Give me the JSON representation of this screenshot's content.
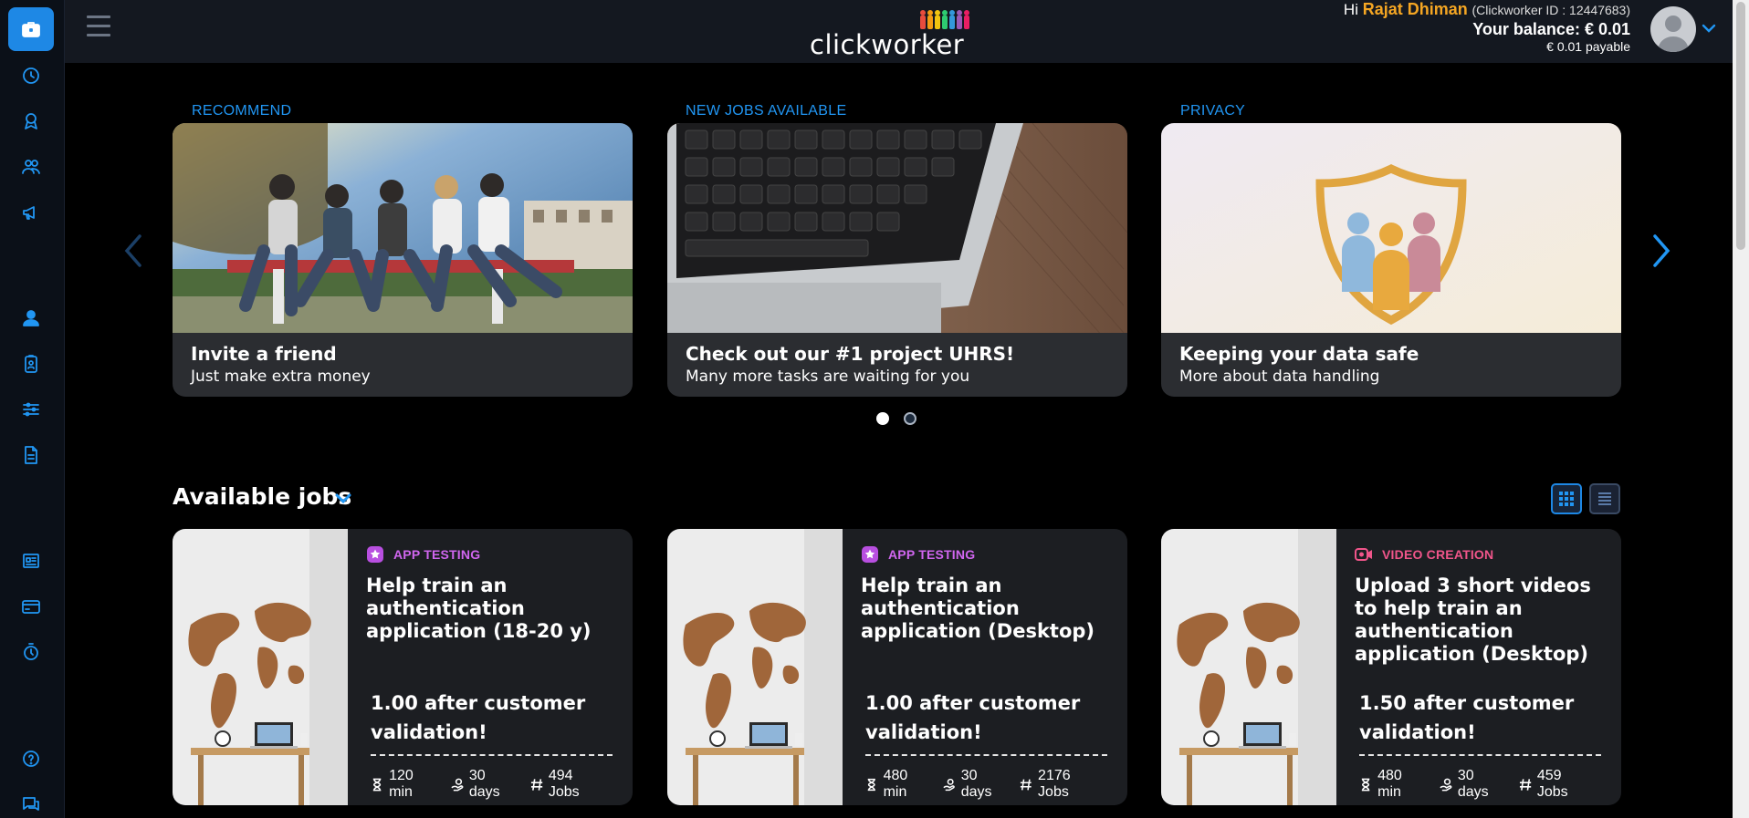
{
  "header": {
    "greeting": "Hi",
    "user_name": "Rajat Dhiman",
    "clickworker_id": "(Clickworker ID : 12447683)",
    "balance": "Your balance: € 0.01",
    "payable": "€ 0.01 payable",
    "logo_text": "clickworker"
  },
  "sidebar": {
    "items": [
      {
        "icon": "briefcase-icon"
      },
      {
        "icon": "timer-icon"
      },
      {
        "icon": "badge-icon"
      },
      {
        "icon": "users-icon"
      },
      {
        "icon": "megaphone-icon"
      },
      {
        "icon": "user-icon"
      },
      {
        "icon": "clipboard-user-icon"
      },
      {
        "icon": "sliders-icon"
      },
      {
        "icon": "document-icon"
      },
      {
        "icon": "news-icon"
      },
      {
        "icon": "credit-card-icon"
      },
      {
        "icon": "payout-timer-icon"
      },
      {
        "icon": "help-icon"
      },
      {
        "icon": "chat-icon"
      }
    ]
  },
  "carousel": {
    "slides": [
      {
        "label": "RECOMMEND",
        "title": "Invite a friend",
        "subtitle": "Just make extra money"
      },
      {
        "label": "NEW JOBS AVAILABLE",
        "title": "Check out our #1 project UHRS!",
        "subtitle": "Many more tasks are waiting for you"
      },
      {
        "label": "PRIVACY",
        "title": "Keeping your data safe",
        "subtitle": "More about data handling"
      }
    ],
    "active_dot": 1,
    "dot_count": 2
  },
  "jobs": {
    "heading": "Available jobs",
    "cards": [
      {
        "category": "APP TESTING",
        "category_color": "#d066ef",
        "category_icon": "star-badge-icon",
        "title": "Help train an authentication application (18-20 y)",
        "price": "1.00 after customer validation!",
        "duration": "120 min",
        "deadline": "30 days",
        "jobs": "494 Jobs"
      },
      {
        "category": "APP TESTING",
        "category_color": "#d066ef",
        "category_icon": "star-badge-icon",
        "title": "Help train an authentication application (Desktop)",
        "price": "1.00 after customer validation!",
        "duration": "480 min",
        "deadline": "30 days",
        "jobs": "2176 Jobs"
      },
      {
        "category": "VIDEO CREATION",
        "category_color": "#f0558a",
        "category_icon": "video-camera-icon",
        "title": "Upload 3 short videos to help train an authentication application (Desktop)",
        "price": "1.50 after customer validation!",
        "duration": "480 min",
        "deadline": "30 days",
        "jobs": "459 Jobs"
      }
    ]
  },
  "colors": {
    "accent": "#2196f3",
    "username": "#f5a623"
  }
}
